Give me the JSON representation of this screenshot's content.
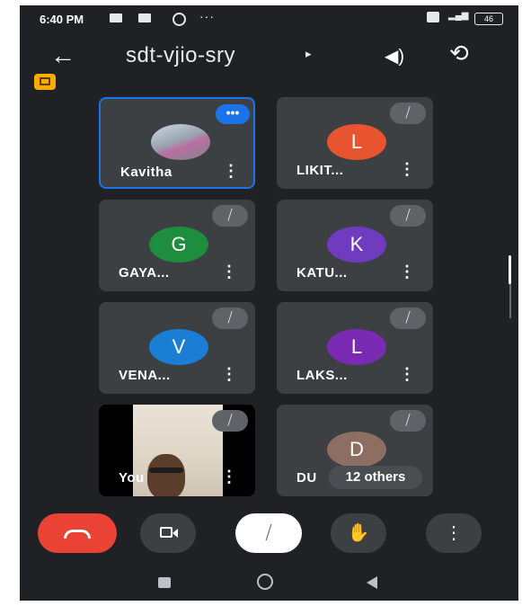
{
  "status_bar": {
    "time": "6:40 PM",
    "more": "···",
    "battery": "46"
  },
  "meeting": {
    "code": "sdt-vjio-sry",
    "code_arrow": "▸",
    "back": "←",
    "speaker": "◀)",
    "switch_camera": "⟲"
  },
  "participants": [
    {
      "name": "Kavitha",
      "avatar": "photo",
      "active_speaker": true
    },
    {
      "name": "LIKIT...",
      "initial": "L",
      "color": "#e8542f",
      "muted": true
    },
    {
      "name": "GAYA...",
      "initial": "G",
      "color": "#1e8e3e",
      "muted": true
    },
    {
      "name": "KATU...",
      "initial": "K",
      "color": "#6f3bbf",
      "muted": true
    },
    {
      "name": "VENA...",
      "initial": "V",
      "color": "#1a7fd4",
      "muted": true
    },
    {
      "name": "LAKS...",
      "initial": "L",
      "color": "#7b2bb3",
      "muted": true
    },
    {
      "name": "You",
      "avatar": "self-video",
      "muted": true
    },
    {
      "name": "DU",
      "initial": "D",
      "color": "#8d6e63",
      "muted": true,
      "others_label": "12 others"
    }
  ],
  "icons": {
    "kebab": "⋮",
    "mute": "🎙̸",
    "more_dots": "•••"
  }
}
